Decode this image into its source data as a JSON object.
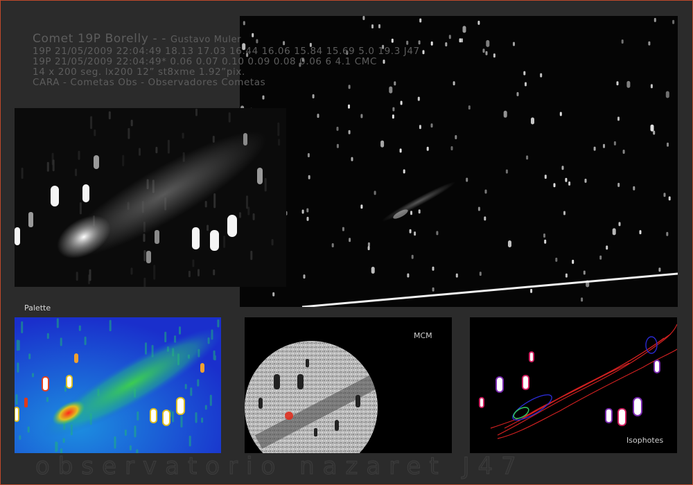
{
  "caption": {
    "title": "Comet 19P Borelly - - ",
    "author": "Gustavo Muler",
    "line2": "19P 21/05/2009 22:04:49 18.13 17.03 16.44 16.06 15.84 15.69 5.0 19.3 J47",
    "line3": "19P 21/05/2009 22:04:49* 0.06 0.07 0.10 0.09 0.08 0.06 6 4.1 CMC",
    "line4": "14 x 200 seg. lx200 12” st8xme 1.92”pix.",
    "line5": "CARA - Cometas Obs -  Observadores Cometas"
  },
  "panels": {
    "palette_label": "Palette",
    "mcm_label": "MCM",
    "isophotes_label": "Isophotes"
  },
  "footer": "observatorio nazaret J47",
  "colors": {
    "frame": "#c0492b",
    "background": "#2b2b2b",
    "caption": "#5d5d5d"
  }
}
